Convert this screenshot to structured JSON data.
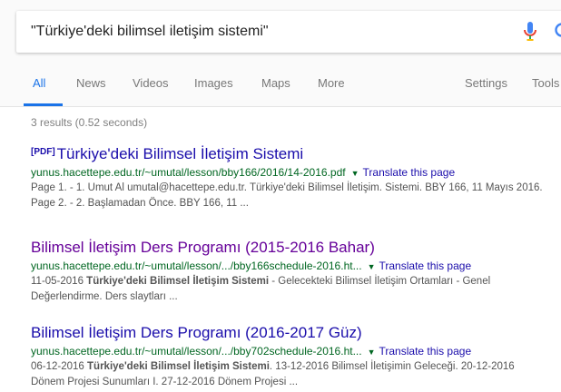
{
  "search": {
    "query": "\"Türkiye'deki bilimsel iletişim sistemi\""
  },
  "tabs": [
    {
      "label": "All",
      "active": true
    },
    {
      "label": "News"
    },
    {
      "label": "Videos"
    },
    {
      "label": "Images"
    },
    {
      "label": "Maps"
    },
    {
      "label": "More"
    },
    {
      "label": "Settings"
    },
    {
      "label": "Tools"
    }
  ],
  "stats": "3 results (0.52 seconds)",
  "results": [
    {
      "tag": "[PDF]",
      "title": "Türkiye'deki Bilimsel İletişim Sistemi",
      "url": "yunus.hacettepe.edu.tr/~umutal/lesson/bby166/2016/14-2016.pdf",
      "translate": "Translate this page",
      "snippet_parts": [
        {
          "text": "Page 1. - 1. Umut Al umutal@hacettepe.edu.tr. Türkiye'deki Bilimsel İletişim. Sistemi. BBY 166, 11 Mayıs 2016. Page 2. - 2. Başlamadan Önce. BBY 166, 11 ...",
          "bold": false
        }
      ]
    },
    {
      "title": "Bilimsel İletişim Ders Programı (2015-2016 Bahar)",
      "url": "yunus.hacettepe.edu.tr/~umutal/lesson/.../bby166schedule-2016.ht...",
      "translate": "Translate this page",
      "snippet_parts": [
        {
          "text": "11-05-2016 ",
          "bold": false
        },
        {
          "text": "Türkiye'deki Bilimsel İletişim Sistemi",
          "bold": true
        },
        {
          "text": " - Gelecekteki Bilimsel İletişim Ortamları - Genel Değerlendirme. Ders slaytları ...",
          "bold": false
        }
      ]
    },
    {
      "title": "Bilimsel İletişim Ders Programı (2016-2017 Güz)",
      "url": "yunus.hacettepe.edu.tr/~umutal/lesson/.../bby702schedule-2016.ht...",
      "translate": "Translate this page",
      "snippet_parts": [
        {
          "text": "06-12-2016 ",
          "bold": false
        },
        {
          "text": "Türkiye'deki Bilimsel İletişim Sistemi",
          "bold": true
        },
        {
          "text": ". 13-12-2016 Bilimsel İletişimin Geleceği. 20-12-2016 Dönem Projesi Sunumları I. 27-12-2016 Dönem Projesi ...",
          "bold": false
        }
      ]
    }
  ],
  "colors": {
    "link": "#1a0dab",
    "visited": "#660099",
    "url": "#006621",
    "accent": "#1a73e8",
    "mic_red": "#ea4335"
  },
  "icons": {
    "mic": "mic-icon",
    "search": "search-icon",
    "caret": "caret-down-icon"
  }
}
